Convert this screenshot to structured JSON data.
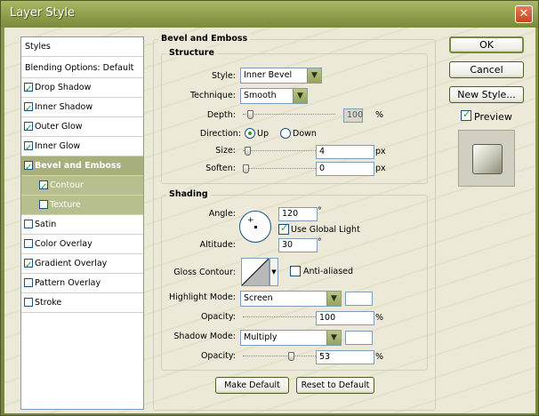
{
  "window": {
    "title": "Layer Style",
    "close_glyph": "✕"
  },
  "styles_list": {
    "header": "Styles",
    "blending": "Blending Options: Default",
    "items": [
      {
        "label": "Drop Shadow",
        "checked": true
      },
      {
        "label": "Inner Shadow",
        "checked": true
      },
      {
        "label": "Outer Glow",
        "checked": true
      },
      {
        "label": "Inner Glow",
        "checked": true
      },
      {
        "label": "Bevel and Emboss",
        "checked": true,
        "selected": true
      },
      {
        "label": "Contour",
        "checked": true,
        "sub": true
      },
      {
        "label": "Texture",
        "checked": false,
        "sub": true
      },
      {
        "label": "Satin",
        "checked": false
      },
      {
        "label": "Color Overlay",
        "checked": false
      },
      {
        "label": "Gradient Overlay",
        "checked": true
      },
      {
        "label": "Pattern Overlay",
        "checked": false
      },
      {
        "label": "Stroke",
        "checked": false
      }
    ]
  },
  "bevel": {
    "title": "Bevel and Emboss",
    "structure": {
      "title": "Structure",
      "style_label": "Style:",
      "style_value": "Inner Bevel",
      "technique_label": "Technique:",
      "technique_value": "Smooth",
      "depth_label": "Depth:",
      "depth_value": "100",
      "depth_unit": "%",
      "depth_level": 0.05,
      "direction_label": "Direction:",
      "direction_up": "Up",
      "direction_down": "Down",
      "direction_selected": "Up",
      "size_label": "Size:",
      "size_value": "4",
      "size_unit": "px",
      "size_level": 0.02,
      "soften_label": "Soften:",
      "soften_value": "0",
      "soften_unit": "px",
      "soften_level": 0.0
    },
    "shading": {
      "title": "Shading",
      "angle_label": "Angle:",
      "angle_value": "120",
      "angle_unit": "°",
      "global_light_label": "Use Global Light",
      "global_light_checked": true,
      "altitude_label": "Altitude:",
      "altitude_value": "30",
      "altitude_unit": "°",
      "gloss_label": "Gloss Contour:",
      "anti_aliased_label": "Anti-aliased",
      "anti_aliased_checked": false,
      "highlight_mode_label": "Highlight Mode:",
      "highlight_mode_value": "Screen",
      "highlight_opacity_label": "Opacity:",
      "highlight_opacity_value": "100",
      "highlight_opacity_unit": "%",
      "highlight_opacity_level": 1.0,
      "shadow_mode_label": "Shadow Mode:",
      "shadow_mode_value": "Multiply",
      "shadow_opacity_label": "Opacity:",
      "shadow_opacity_value": "53",
      "shadow_opacity_unit": "%",
      "shadow_opacity_level": 0.53,
      "highlight_color": "#ffffff",
      "shadow_color": "#ffffff"
    },
    "make_default": "Make Default",
    "reset_default": "Reset to Default"
  },
  "actions": {
    "ok": "OK",
    "cancel": "Cancel",
    "new_style": "New Style...",
    "preview_label": "Preview",
    "preview_checked": true
  },
  "colors": {
    "accent": "#7a8a3c",
    "selected_row": "#a7b07c",
    "check": "#21a121"
  }
}
